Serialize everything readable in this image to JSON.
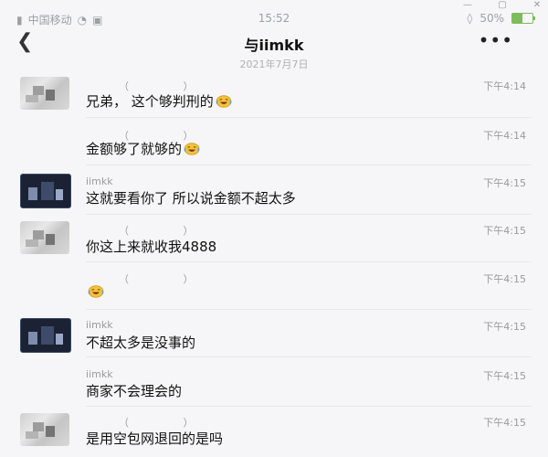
{
  "status_bar": {
    "carrier": "中国移动",
    "time": "15:52",
    "battery": "50%"
  },
  "header": {
    "title": "与iimkk",
    "back_icon": "chevron-left-icon",
    "more_label": "•••"
  },
  "date_separator": "2021年7月7日",
  "messages": [
    {
      "sender": "（        ）",
      "time": "下午4:14",
      "text": "兄弟， 这个够判刑的",
      "emoji": true
    },
    {
      "sender": "（        ）",
      "time": "下午4:14",
      "text": "金额够了就够的",
      "emoji": true
    },
    {
      "sender": "iimkk",
      "time": "下午4:15",
      "text": "这就要看你了 所以说金额不超太多",
      "emoji": false
    },
    {
      "sender": "（        ）",
      "time": "下午4:15",
      "text": "你这上来就收我4888",
      "emoji": false
    },
    {
      "sender": "（        ）",
      "time": "下午4:15",
      "text": "",
      "emoji": true
    },
    {
      "sender": "iimkk",
      "time": "下午4:15",
      "text": "不超太多是没事的",
      "emoji": false
    },
    {
      "sender": "iimkk",
      "time": "下午4:15",
      "text": "商家不会理会的",
      "emoji": false
    },
    {
      "sender": "（        ）",
      "time": "下午4:15",
      "text": "是用空包网退回的是吗",
      "emoji": false
    }
  ],
  "colors": {
    "background": "#f6f6f8",
    "battery": "#7dbb5b",
    "muted_text": "#9a9a9a"
  }
}
